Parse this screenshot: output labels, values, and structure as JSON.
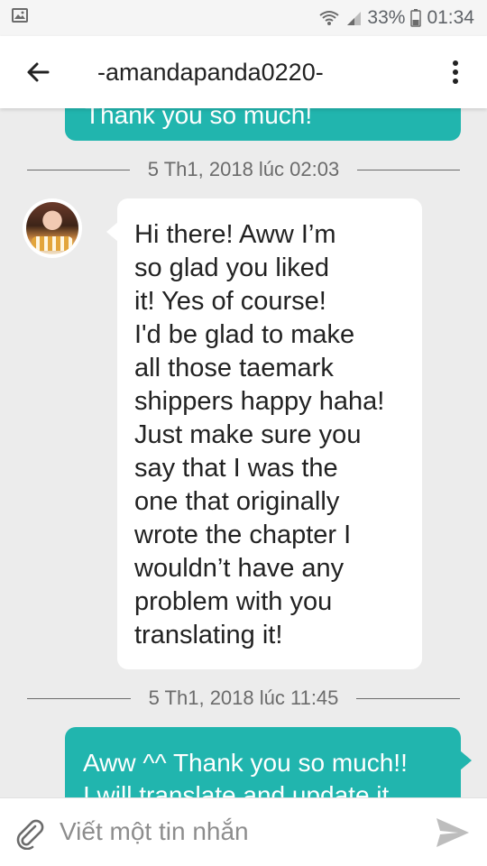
{
  "status_bar": {
    "battery": "33%",
    "time": "01:34",
    "icons": [
      "image-notification-icon",
      "wifi-icon",
      "signal-icon",
      "battery-icon"
    ]
  },
  "header": {
    "title": "-amandapanda0220-",
    "back_icon": "arrow-left-icon",
    "menu_icon": "more-vertical-icon"
  },
  "messages": {
    "outgoing_top": {
      "text": "Thank you so much!"
    },
    "separator_1": "5 Th1, 2018 lúc 02:03",
    "incoming": {
      "lines": [
        "Hi there! Aww I’m",
        "so glad you liked",
        "it! Yes of course!",
        "I'd be glad to make",
        "all those taemark",
        "shippers happy haha!",
        "Just make sure you",
        "say that I was the",
        "one that originally",
        "wrote the chapter I",
        "wouldn’t have any",
        "problem with you",
        "translating it!"
      ]
    },
    "separator_2": "5 Th1, 2018 lúc 11:45",
    "outgoing_bottom": {
      "lines": [
        "Aww ^^ Thank you so much!!",
        "I will translate and update it"
      ]
    }
  },
  "composer": {
    "placeholder": "Viết một tin nhắn",
    "value": "",
    "attach_icon": "paperclip-icon",
    "send_icon": "send-icon"
  },
  "colors": {
    "accent": "#21b5ae",
    "background": "#ececec",
    "incoming_bubble": "#ffffff",
    "separator_text": "#6b6b6b"
  }
}
